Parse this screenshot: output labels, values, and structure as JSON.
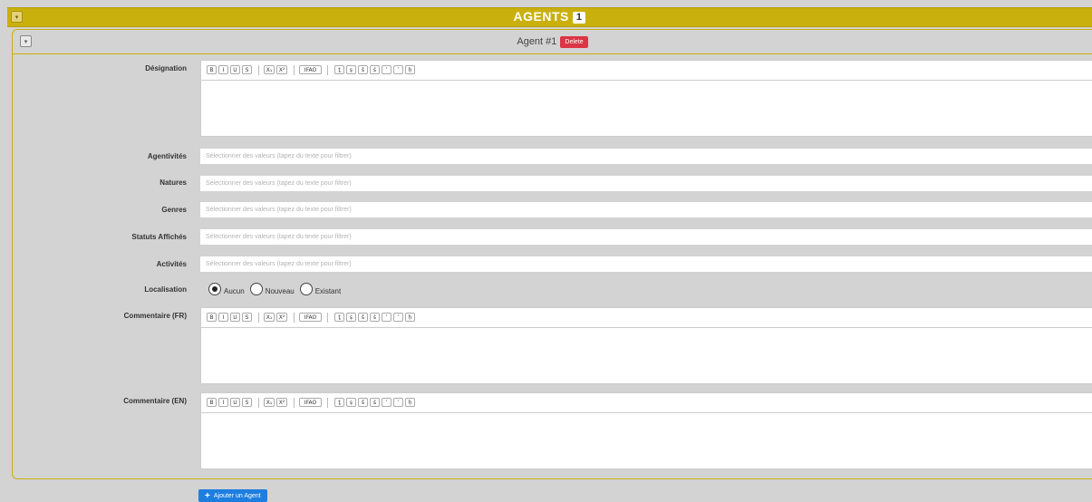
{
  "header": {
    "title": "AGENTS",
    "count": "1",
    "toggle_icon": "▾"
  },
  "agent": {
    "title": "Agent #1",
    "delete_label": "Delete",
    "toggle_icon": "▾"
  },
  "toolbar": {
    "bold": "B",
    "italic": "I",
    "underline": "U",
    "strike": "S",
    "subscript": "X₁",
    "superscript": "X²",
    "ifao": "IFAO",
    "chars": [
      "ṯ",
      "ṣ",
      "š",
      "ś",
      "ʿ",
      "ʾ",
      "ḥ"
    ]
  },
  "fields": {
    "designation": "Désignation",
    "agentivites": "Agentivités",
    "natures": "Natures",
    "genres": "Genres",
    "statuts": "Statuts Affichés",
    "activites": "Activités",
    "localisation": "Localisation",
    "comment_fr": "Commentaire (FR)",
    "comment_en": "Commentaire (EN)"
  },
  "select_placeholder": "Sélectionner des valeurs (tapez du texte pour filtrer)",
  "localisation_options": [
    "Aucun",
    "Nouveau",
    "Existant"
  ],
  "localisation_selected": "Aucun",
  "add_agent_label": "Ajouter un Agent"
}
